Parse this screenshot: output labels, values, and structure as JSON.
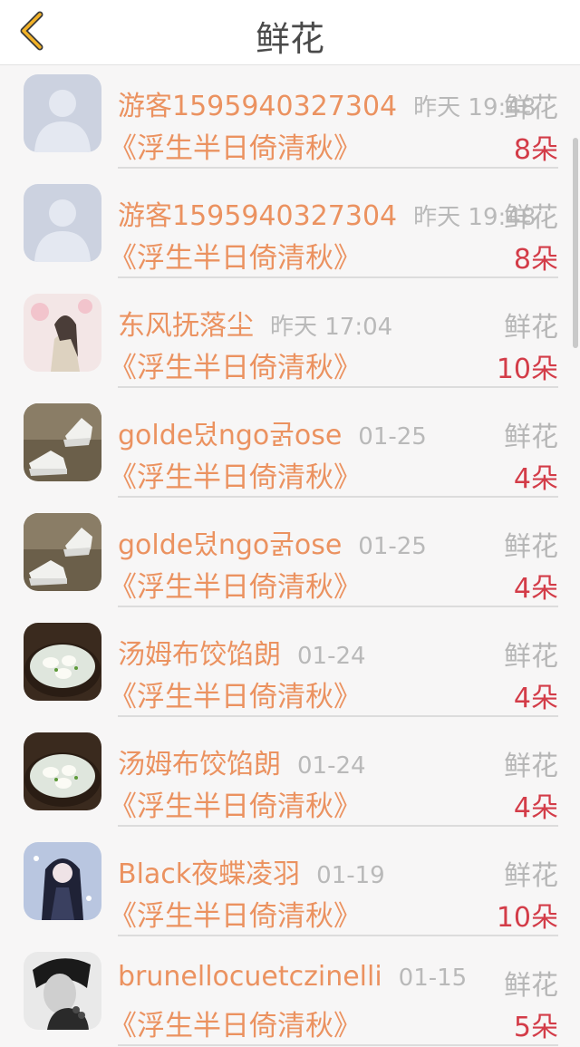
{
  "header": {
    "title": "鲜花",
    "back_icon": "chevron-left-icon",
    "accent": "#f2b227"
  },
  "items": [
    {
      "avatar": "default-user-avatar",
      "name": "游客1595940327304",
      "time": "昨天 19:48",
      "label": "鲜花",
      "book": "《浮生半日倚清秋》",
      "count": "8朵"
    },
    {
      "avatar": "default-user-avatar",
      "name": "游客1595940327304",
      "time": "昨天 19:48",
      "label": "鲜花",
      "book": "《浮生半日倚清秋》",
      "count": "8朵"
    },
    {
      "avatar": "ancient-figure-avatar",
      "name": "东风抚落尘",
      "time": "昨天 17:04",
      "label": "鲜花",
      "book": "《浮生半日倚清秋》",
      "count": "10朵"
    },
    {
      "avatar": "sneakers-avatar",
      "name": "golde뎠ngo굵ose",
      "time": "01-25",
      "label": "鲜花",
      "book": "《浮生半日倚清秋》",
      "count": "4朵"
    },
    {
      "avatar": "sneakers-avatar",
      "name": "golde뎠ngo굵ose",
      "time": "01-25",
      "label": "鲜花",
      "book": "《浮生半日倚清秋》",
      "count": "4朵"
    },
    {
      "avatar": "dumpling-soup-avatar",
      "name": "汤姆布饺馅朗",
      "time": "01-24",
      "label": "鲜花",
      "book": "《浮生半日倚清秋》",
      "count": "4朵"
    },
    {
      "avatar": "dumpling-soup-avatar",
      "name": "汤姆布饺馅朗",
      "time": "01-24",
      "label": "鲜花",
      "book": "《浮生半日倚清秋》",
      "count": "4朵"
    },
    {
      "avatar": "anime-character-avatar",
      "name": "Black夜蝶凌羽",
      "time": "01-19",
      "label": "鲜花",
      "book": "《浮生半日倚清秋》",
      "count": "10朵"
    },
    {
      "avatar": "bw-portrait-avatar",
      "name": "brunellocuetczinelli",
      "time": "01-15",
      "label": "鲜花",
      "book": "《浮生半日倚清秋》",
      "count": "5朵"
    }
  ]
}
